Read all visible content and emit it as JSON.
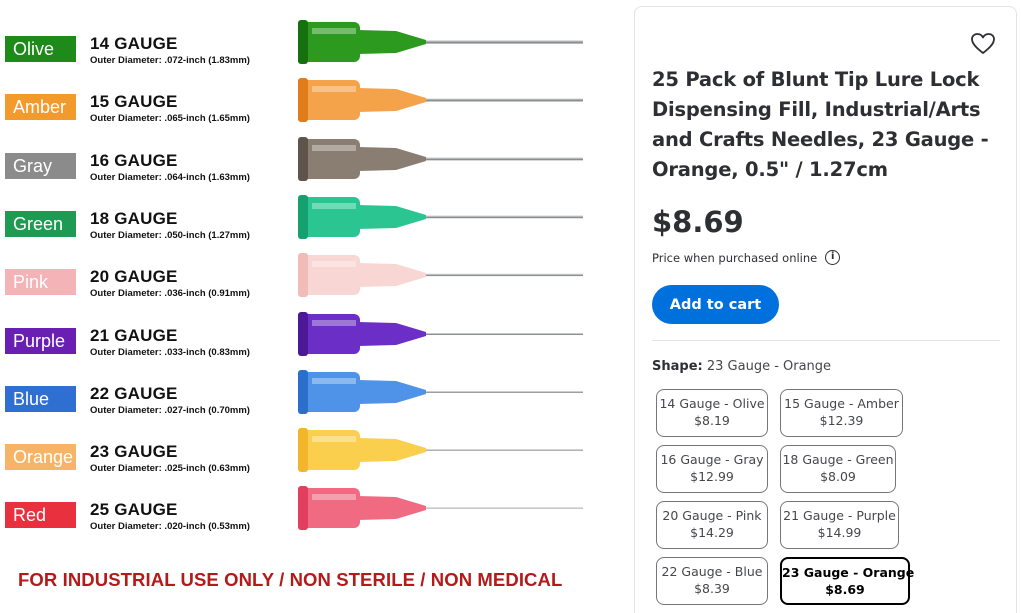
{
  "image": {
    "needles": [
      {
        "color_name": "Olive",
        "color": "#1e8a1a",
        "hub": "#2c9a1e",
        "hub_dark": "#167010",
        "gauge": "14 GAUGE",
        "od": "Outer Diameter: .072-inch (1.83mm)"
      },
      {
        "color_name": "Amber",
        "color": "#f39a2c",
        "hub": "#f5a34a",
        "hub_dark": "#e07d1a",
        "gauge": "15 GAUGE",
        "od": "Outer Diameter: .065-inch (1.65mm)"
      },
      {
        "color_name": "Gray",
        "color": "#8b8b8b",
        "hub": "#8a7d72",
        "hub_dark": "#5e544c",
        "gauge": "16 GAUGE",
        "od": "Outer Diameter: .064-inch (1.63mm)"
      },
      {
        "color_name": "Green",
        "color": "#1f9a52",
        "hub": "#2bc592",
        "hub_dark": "#15a070",
        "gauge": "18 GAUGE",
        "od": "Outer Diameter: .050-inch (1.27mm)"
      },
      {
        "color_name": "Pink",
        "color": "#f4b3b6",
        "hub": "#f8d6d3",
        "hub_dark": "#efbcb8",
        "gauge": "20 GAUGE",
        "od": "Outer Diameter: .036-inch (0.91mm)"
      },
      {
        "color_name": "Purple",
        "color": "#6a1fb3",
        "hub": "#6b2fc7",
        "hub_dark": "#4c1896",
        "gauge": "21 GAUGE",
        "od": "Outer Diameter: .033-inch (0.83mm)"
      },
      {
        "color_name": "Blue",
        "color": "#2e6fd1",
        "hub": "#4f93e8",
        "hub_dark": "#2b6fcc",
        "gauge": "22 GAUGE",
        "od": "Outer Diameter: .027-inch (0.70mm)"
      },
      {
        "color_name": "Orange",
        "color": "#f8b466",
        "hub": "#fbcf4e",
        "hub_dark": "#f2b62a",
        "gauge": "23 GAUGE",
        "od": "Outer Diameter: .025-inch (0.63mm)"
      },
      {
        "color_name": "Red",
        "color": "#e8303f",
        "hub": "#f06a82",
        "hub_dark": "#e0405e",
        "gauge": "25 GAUGE",
        "od": "Outer Diameter: .020-inch (0.53mm)"
      }
    ],
    "disclaimer": "FOR INDUSTRIAL USE ONLY / NON STERILE / NON MEDICAL"
  },
  "product": {
    "favorite_icon": "heart-icon",
    "title": "25 Pack of Blunt Tip Lure Lock Dispensing Fill, Industrial/Arts and Crafts Needles, 23 Gauge - Orange, 0.5\" / 1.27cm",
    "price": "$8.69",
    "price_note": "Price when purchased online",
    "info_icon": "info-icon",
    "add_to_cart": "Add to cart",
    "accent_color": "#0071dc",
    "shape_label": "Shape:",
    "shape_value": "23 Gauge - Orange",
    "variants": [
      {
        "name": "14 Gauge - Olive",
        "price": "$8.19"
      },
      {
        "name": "15 Gauge - Amber",
        "price": "$12.39"
      },
      {
        "name": "16 Gauge - Gray",
        "price": "$12.99"
      },
      {
        "name": "18 Gauge - Green",
        "price": "$8.09"
      },
      {
        "name": "20 Gauge - Pink",
        "price": "$14.29"
      },
      {
        "name": "21 Gauge - Purple",
        "price": "$14.99"
      },
      {
        "name": "22 Gauge - Blue",
        "price": "$8.39"
      },
      {
        "name": "23 Gauge - Orange",
        "price": "$8.69",
        "selected": true
      }
    ]
  }
}
